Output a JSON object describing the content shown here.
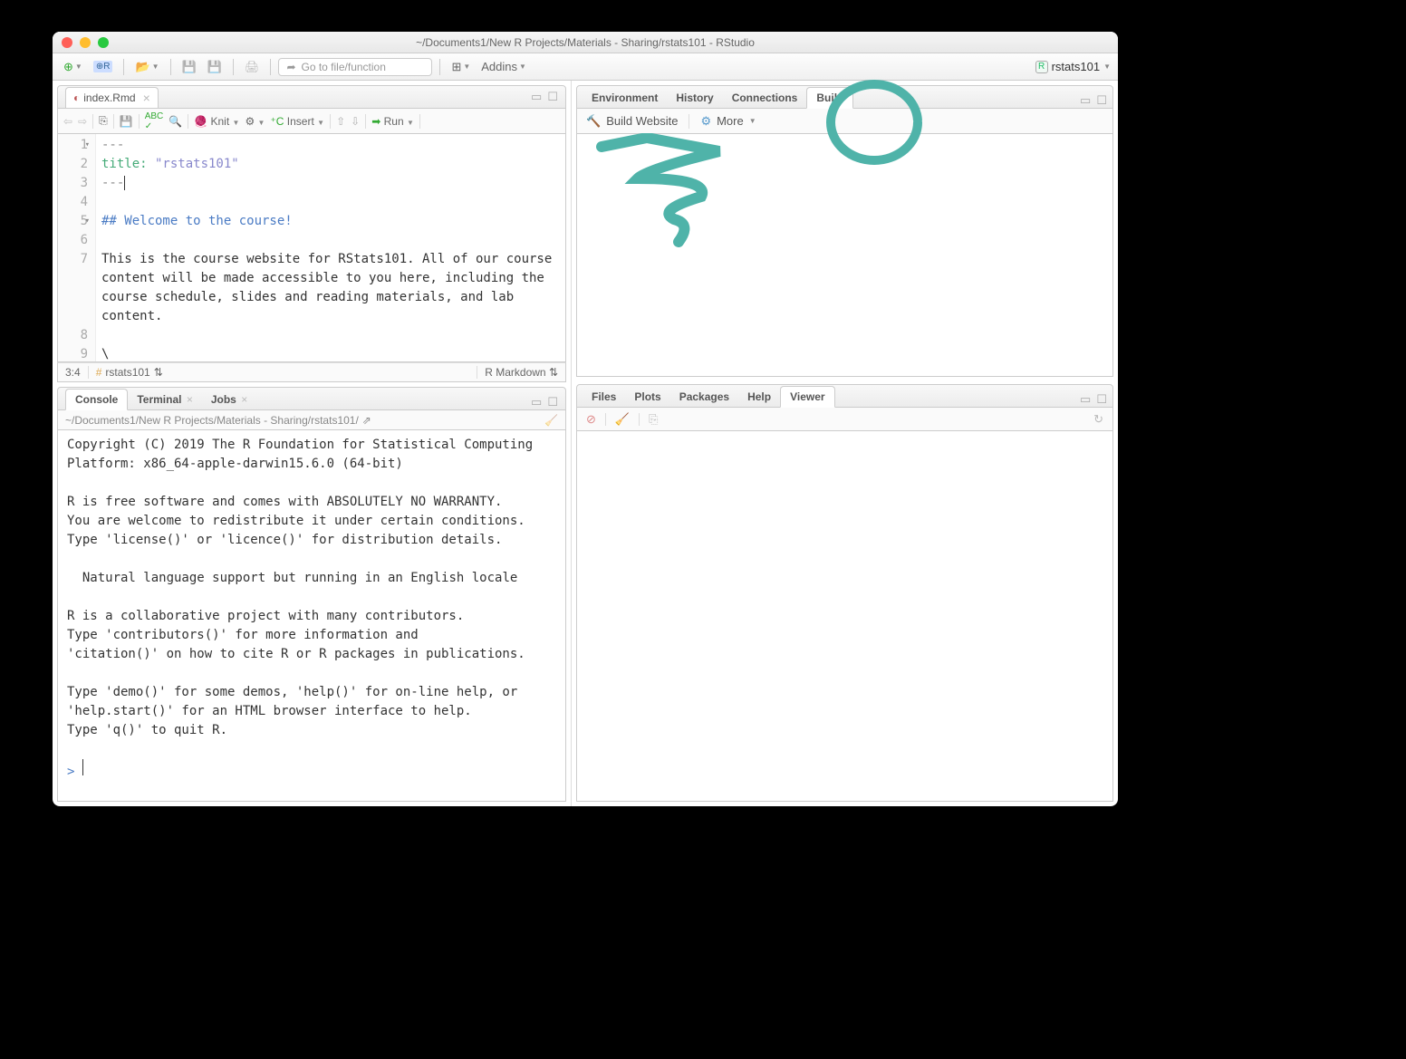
{
  "window_title": "~/Documents1/New R Projects/Materials - Sharing/rstats101 - RStudio",
  "toolbar": {
    "goto_placeholder": "Go to file/function",
    "addins": "Addins"
  },
  "project_name": "rstats101",
  "editor": {
    "filename": "index.Rmd",
    "run_label": "Run",
    "knit_label": "Knit",
    "insert_label": "Insert",
    "lines": {
      "l1": "---",
      "l2a": "title:",
      "l2b": " \"rstats101\"",
      "l3": "---",
      "l5": "## Welcome to the course!",
      "l7": "This is the course website for RStats101. All of our course content will be made accessible to you here, including the course schedule, slides and reading materials, and lab content.",
      "l9": "\\"
    },
    "status_pos": "3:4",
    "status_chunk": "rstats101",
    "status_lang": "R Markdown"
  },
  "console": {
    "tabs": [
      "Console",
      "Terminal",
      "Jobs"
    ],
    "path": "~/Documents1/New R Projects/Materials - Sharing/rstats101/",
    "text": "Copyright (C) 2019 The R Foundation for Statistical Computing\nPlatform: x86_64-apple-darwin15.6.0 (64-bit)\n\nR is free software and comes with ABSOLUTELY NO WARRANTY.\nYou are welcome to redistribute it under certain conditions.\nType 'license()' or 'licence()' for distribution details.\n\n  Natural language support but running in an English locale\n\nR is a collaborative project with many contributors.\nType 'contributors()' for more information and\n'citation()' on how to cite R or R packages in publications.\n\nType 'demo()' for some demos, 'help()' for on-line help, or\n'help.start()' for an HTML browser interface to help.\nType 'q()' to quit R.\n",
    "prompt": "> "
  },
  "top_right": {
    "tabs": [
      "Environment",
      "History",
      "Connections",
      "Build"
    ],
    "build_btn": "Build Website",
    "more_btn": "More"
  },
  "bot_right": {
    "tabs": [
      "Files",
      "Plots",
      "Packages",
      "Help",
      "Viewer"
    ]
  }
}
